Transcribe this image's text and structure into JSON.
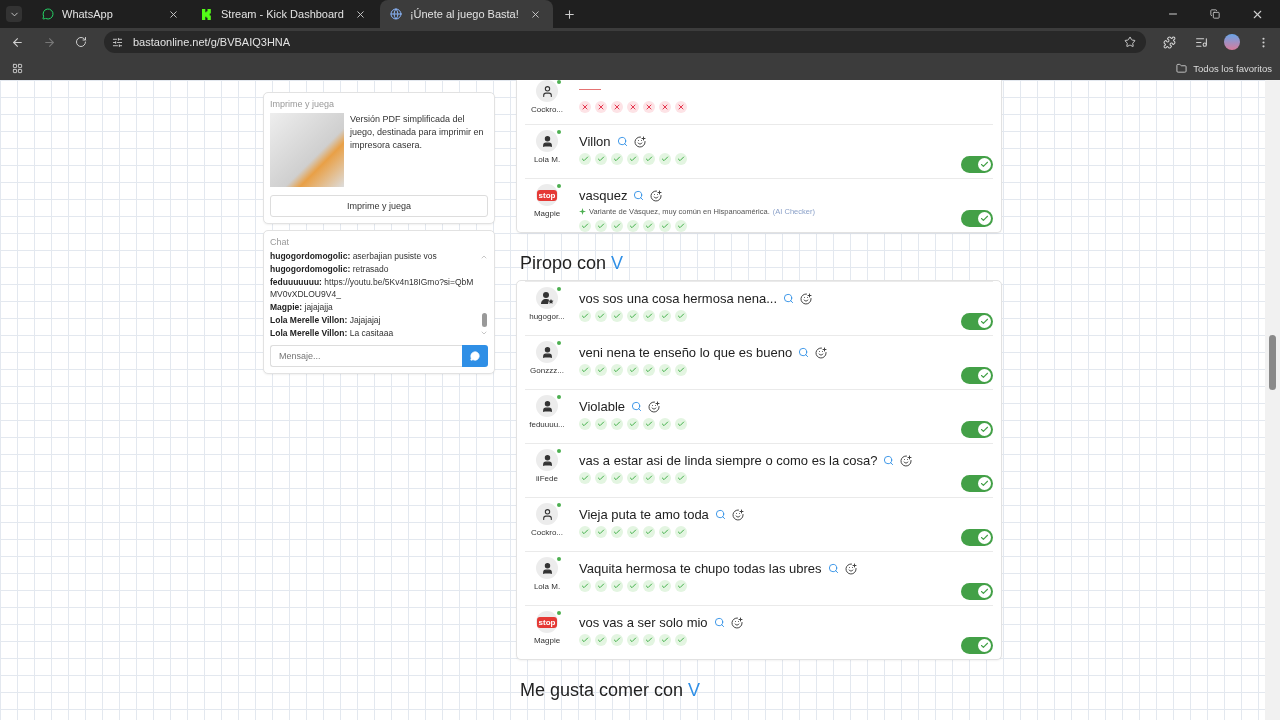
{
  "browser": {
    "tabs": [
      {
        "title": "WhatsApp",
        "selected": false
      },
      {
        "title": "Stream - Kick Dashboard",
        "selected": false
      },
      {
        "title": "¡Únete al juego Basta!",
        "selected": true
      }
    ],
    "url": "bastaonline.net/g/BVBAIQ3HNA",
    "bookmarks_label": "Todos los favoritos"
  },
  "print_card": {
    "title": "Imprime y juega",
    "description": "Versión PDF simplificada del juego, destinada para imprimir en impresora casera.",
    "button": "Imprime y juega"
  },
  "chat": {
    "title": "Chat",
    "messages": [
      {
        "author": "hugogordomogolic:",
        "text": "aserbajian pusiste vos"
      },
      {
        "author": "hugogordomogolic:",
        "text": "retrasado"
      },
      {
        "author": "feduuuuuuu:",
        "text": "https://youtu.be/5Kv4n18IGmo?si=QbMMV0vXDLOU9V4_"
      },
      {
        "author": "Magpie:",
        "text": "jajajajja"
      },
      {
        "author": "Lola Merelle Villon:",
        "text": "Jajajajaj"
      },
      {
        "author": "Lola Merelle Villon:",
        "text": "La casitaaa"
      }
    ],
    "placeholder": "Mensaje..."
  },
  "sections": [
    {
      "answers": [
        {
          "player": "Cockro...",
          "kind": "outline",
          "votes": [
            false,
            false,
            false,
            false,
            false,
            false,
            false
          ]
        },
        {
          "player": "Lola M.",
          "kind": "person",
          "answer": "Villon",
          "on": true,
          "votes": [
            true,
            true,
            true,
            true,
            true,
            true,
            true
          ]
        },
        {
          "player": "Magpie",
          "kind": "stop",
          "badge": "stop",
          "answer": "vasquez",
          "on": true,
          "note": "Variante de Vásquez, muy común en Hispanoamérica.",
          "note_source": "(AI Checker)",
          "votes": [
            true,
            true,
            true,
            true,
            true,
            true,
            true
          ]
        }
      ]
    },
    {
      "category": "Piropo con",
      "letter": "V",
      "answers": [
        {
          "player": "hugogor...",
          "kind": "star",
          "answer": "vos sos una cosa hermosa nena...",
          "on": true,
          "votes": [
            true,
            true,
            true,
            true,
            true,
            true,
            true
          ]
        },
        {
          "player": "Gonzzz...",
          "kind": "person",
          "answer": "veni nena te enseño lo que es bueno",
          "on": true,
          "votes": [
            true,
            true,
            true,
            true,
            true,
            true,
            true
          ]
        },
        {
          "player": "feduuuu...",
          "kind": "person",
          "answer": "Violable",
          "on": true,
          "votes": [
            true,
            true,
            true,
            true,
            true,
            true,
            true
          ]
        },
        {
          "player": "iiFede",
          "kind": "person",
          "answer": "vas a estar asi de linda siempre o como es la cosa?",
          "on": true,
          "votes": [
            true,
            true,
            true,
            true,
            true,
            true,
            true
          ]
        },
        {
          "player": "Cockro...",
          "kind": "outline",
          "answer": "Vieja puta te amo toda",
          "on": true,
          "votes": [
            true,
            true,
            true,
            true,
            true,
            true,
            true
          ]
        },
        {
          "player": "Lola M.",
          "kind": "person",
          "answer": "Vaquita hermosa te chupo todas las ubres",
          "on": true,
          "votes": [
            true,
            true,
            true,
            true,
            true,
            true,
            true
          ]
        },
        {
          "player": "Magpie",
          "kind": "stop",
          "badge": "stop",
          "answer": "vos vas a ser solo mio",
          "on": true,
          "votes": [
            true,
            true,
            true,
            true,
            true,
            true,
            true
          ]
        }
      ]
    },
    {
      "category": "Me gusta comer con",
      "letter": "V"
    }
  ]
}
